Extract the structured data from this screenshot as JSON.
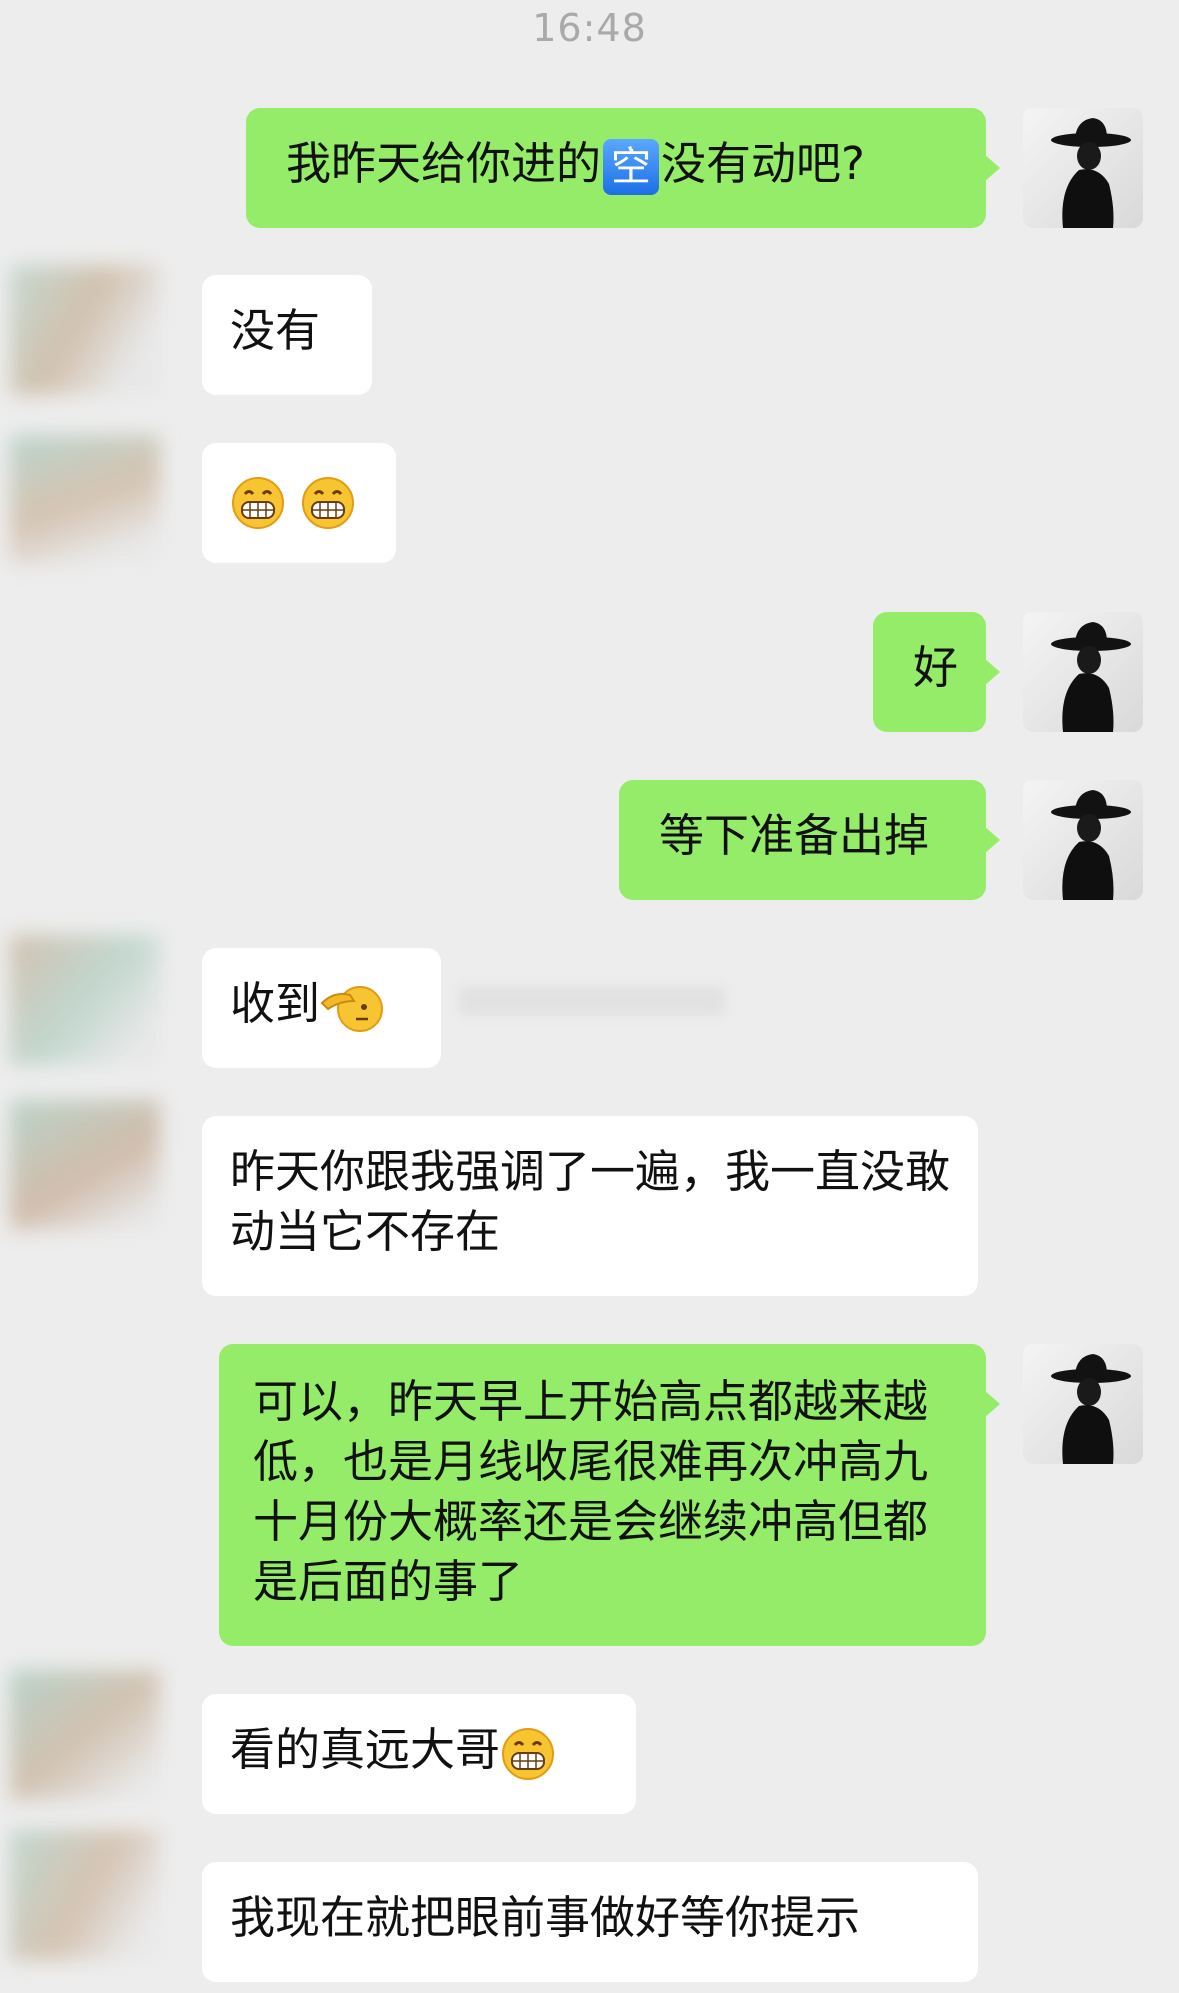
{
  "status_time": "16:48",
  "colors": {
    "background": "#ededed",
    "outgoing_bubble": "#95ec69",
    "incoming_bubble": "#ffffff",
    "timestamp_text": "#a9a9a9"
  },
  "messages": [
    {
      "direction": "outgoing",
      "text_before": "我昨天给你进的",
      "badge": "空",
      "text_after": "没有动吧?",
      "avatar_icon": "hat-figure-icon"
    },
    {
      "direction": "incoming",
      "text": "没有"
    },
    {
      "direction": "incoming",
      "emoji": [
        "grinning-face-icon",
        "grinning-face-icon"
      ]
    },
    {
      "direction": "outgoing",
      "text": "好",
      "avatar_icon": "hat-figure-icon"
    },
    {
      "direction": "outgoing",
      "text": "等下准备出掉",
      "avatar_icon": "hat-figure-icon"
    },
    {
      "direction": "incoming",
      "text": "收到",
      "emoji": [
        "saluting-face-icon"
      ]
    },
    {
      "direction": "incoming",
      "text": "昨天你跟我强调了一遍，我一直没敢动当它不存在"
    },
    {
      "direction": "outgoing",
      "text": "可以，昨天早上开始高点都越来越低，也是月线收尾很难再次冲高九十月份大概率还是会继续冲高但都是后面的事了",
      "avatar_icon": "hat-figure-icon"
    },
    {
      "direction": "incoming",
      "text": "看的真远大哥",
      "emoji": [
        "grinning-face-icon"
      ]
    },
    {
      "direction": "incoming",
      "text": "我现在就把眼前事做好等你提示"
    }
  ]
}
